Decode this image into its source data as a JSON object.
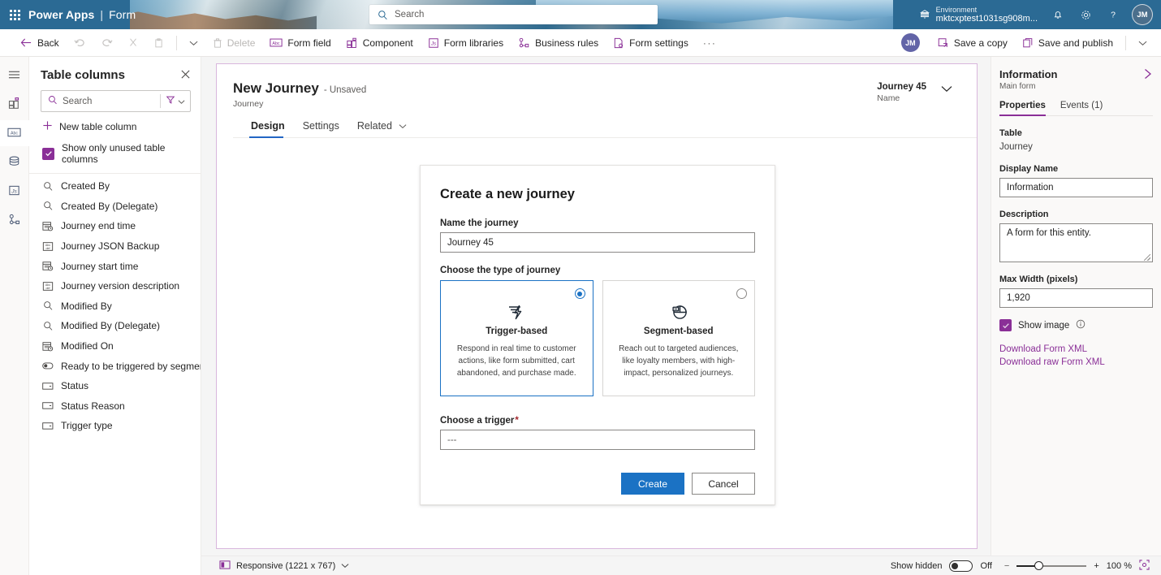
{
  "brand": {
    "waffle_icon": "app-launcher-icon",
    "app_name": "Power Apps",
    "separator": "|",
    "section": "Form",
    "search_placeholder": "Search",
    "environment_label": "Environment",
    "environment_name": "mktcxptest1031sg908m...",
    "notifications_icon": "bell-icon",
    "settings_icon": "gear-icon",
    "help_icon": "question-icon",
    "avatar_initials": "JM"
  },
  "commandbar": {
    "back": "Back",
    "undo_icon": "undo-icon",
    "redo_icon": "redo-icon",
    "cut_icon": "cut-icon",
    "paste_icon": "paste-icon",
    "caret_icon": "chevron-down-icon",
    "delete": "Delete",
    "form_field": "Form field",
    "component": "Component",
    "form_libraries": "Form libraries",
    "business_rules": "Business rules",
    "form_settings": "Form settings",
    "overflow": "···",
    "user_initials": "JM",
    "save_a_copy": "Save a copy",
    "save_and_publish": "Save and publish",
    "publish_caret": "chevron-down-icon"
  },
  "rail": {
    "items": [
      {
        "name": "hamburger-menu-icon"
      },
      {
        "name": "components-icon"
      },
      {
        "name": "table-columns-icon"
      },
      {
        "name": "data-sources-icon"
      },
      {
        "name": "form-libraries-icon"
      },
      {
        "name": "business-rules-icon"
      }
    ]
  },
  "columns_panel": {
    "title": "Table columns",
    "close_icon": "close-icon",
    "search_placeholder": "Search",
    "filter_icon": "filter-icon",
    "filter_caret": "chevron-down-icon",
    "new_column": "New table column",
    "show_unused": "Show only unused table columns",
    "show_unused_checked": true,
    "items": [
      {
        "label": "Created By",
        "icon": "lookup-icon"
      },
      {
        "label": "Created By (Delegate)",
        "icon": "lookup-icon"
      },
      {
        "label": "Journey end time",
        "icon": "datetime-icon"
      },
      {
        "label": "Journey JSON Backup",
        "icon": "text-icon"
      },
      {
        "label": "Journey start time",
        "icon": "datetime-icon"
      },
      {
        "label": "Journey version description",
        "icon": "text-icon"
      },
      {
        "label": "Modified By",
        "icon": "lookup-icon"
      },
      {
        "label": "Modified By (Delegate)",
        "icon": "lookup-icon"
      },
      {
        "label": "Modified On",
        "icon": "datetime-icon"
      },
      {
        "label": "Ready to be triggered by segment r...",
        "icon": "toggle-icon"
      },
      {
        "label": "Status",
        "icon": "choice-icon"
      },
      {
        "label": "Status Reason",
        "icon": "choice-icon"
      },
      {
        "label": "Trigger type",
        "icon": "choice-icon"
      }
    ]
  },
  "form_header": {
    "title": "New Journey",
    "unsaved": "- Unsaved",
    "subtitle": "Journey",
    "record_value": "Journey 45",
    "record_key": "Name",
    "record_caret": "chevron-down-icon",
    "tabs": [
      {
        "label": "Design",
        "active": true
      },
      {
        "label": "Settings",
        "active": false
      },
      {
        "label": "Related",
        "active": false,
        "caret": "chevron-down-icon"
      }
    ]
  },
  "dialog": {
    "title": "Create a new journey",
    "name_label": "Name the journey",
    "name_value": "Journey 45",
    "type_label": "Choose the type of journey",
    "types": [
      {
        "name": "Trigger-based",
        "icon": "lightning-bolt-icon",
        "description": "Respond in real time to customer actions, like form submitted, cart abandoned, and purchase made.",
        "selected": true
      },
      {
        "name": "Segment-based",
        "icon": "pie-chart-icon",
        "description": "Reach out to targeted audiences, like loyalty members, with high-impact, personalized journeys.",
        "selected": false
      }
    ],
    "trigger_label": "Choose a trigger",
    "trigger_required": "*",
    "trigger_value": "---",
    "create_button": "Create",
    "cancel_button": "Cancel"
  },
  "properties": {
    "title": "Information",
    "subtitle": "Main form",
    "expand_icon": "chevron-right-icon",
    "tabs": [
      {
        "label": "Properties",
        "active": true
      },
      {
        "label": "Events (1)",
        "active": false
      }
    ],
    "table_label": "Table",
    "table_value": "Journey",
    "display_name_label": "Display Name",
    "display_name_value": "Information",
    "description_label": "Description",
    "description_value": "A form for this entity.",
    "max_width_label": "Max Width (pixels)",
    "max_width_value": "1,920",
    "show_image_label": "Show image",
    "show_image_checked": true,
    "show_image_info_icon": "info-icon",
    "download_form_xml": "Download Form XML",
    "download_raw_form_xml": "Download raw Form XML"
  },
  "statusbar": {
    "responsive_icon": "device-icon",
    "responsive_label": "Responsive (1221 x 767)",
    "responsive_caret": "chevron-down-icon",
    "show_hidden_label": "Show hidden",
    "show_hidden_state": "Off",
    "zoom_out": "−",
    "zoom_in": "+",
    "zoom_level": "100 %",
    "fit_icon": "fit-to-screen-icon"
  },
  "colors": {
    "brand_bar": "#2b6a94",
    "accent_purple": "#8a2f97",
    "accent_blue": "#1b72c4",
    "canvas_bg": "#f5f5f5"
  }
}
